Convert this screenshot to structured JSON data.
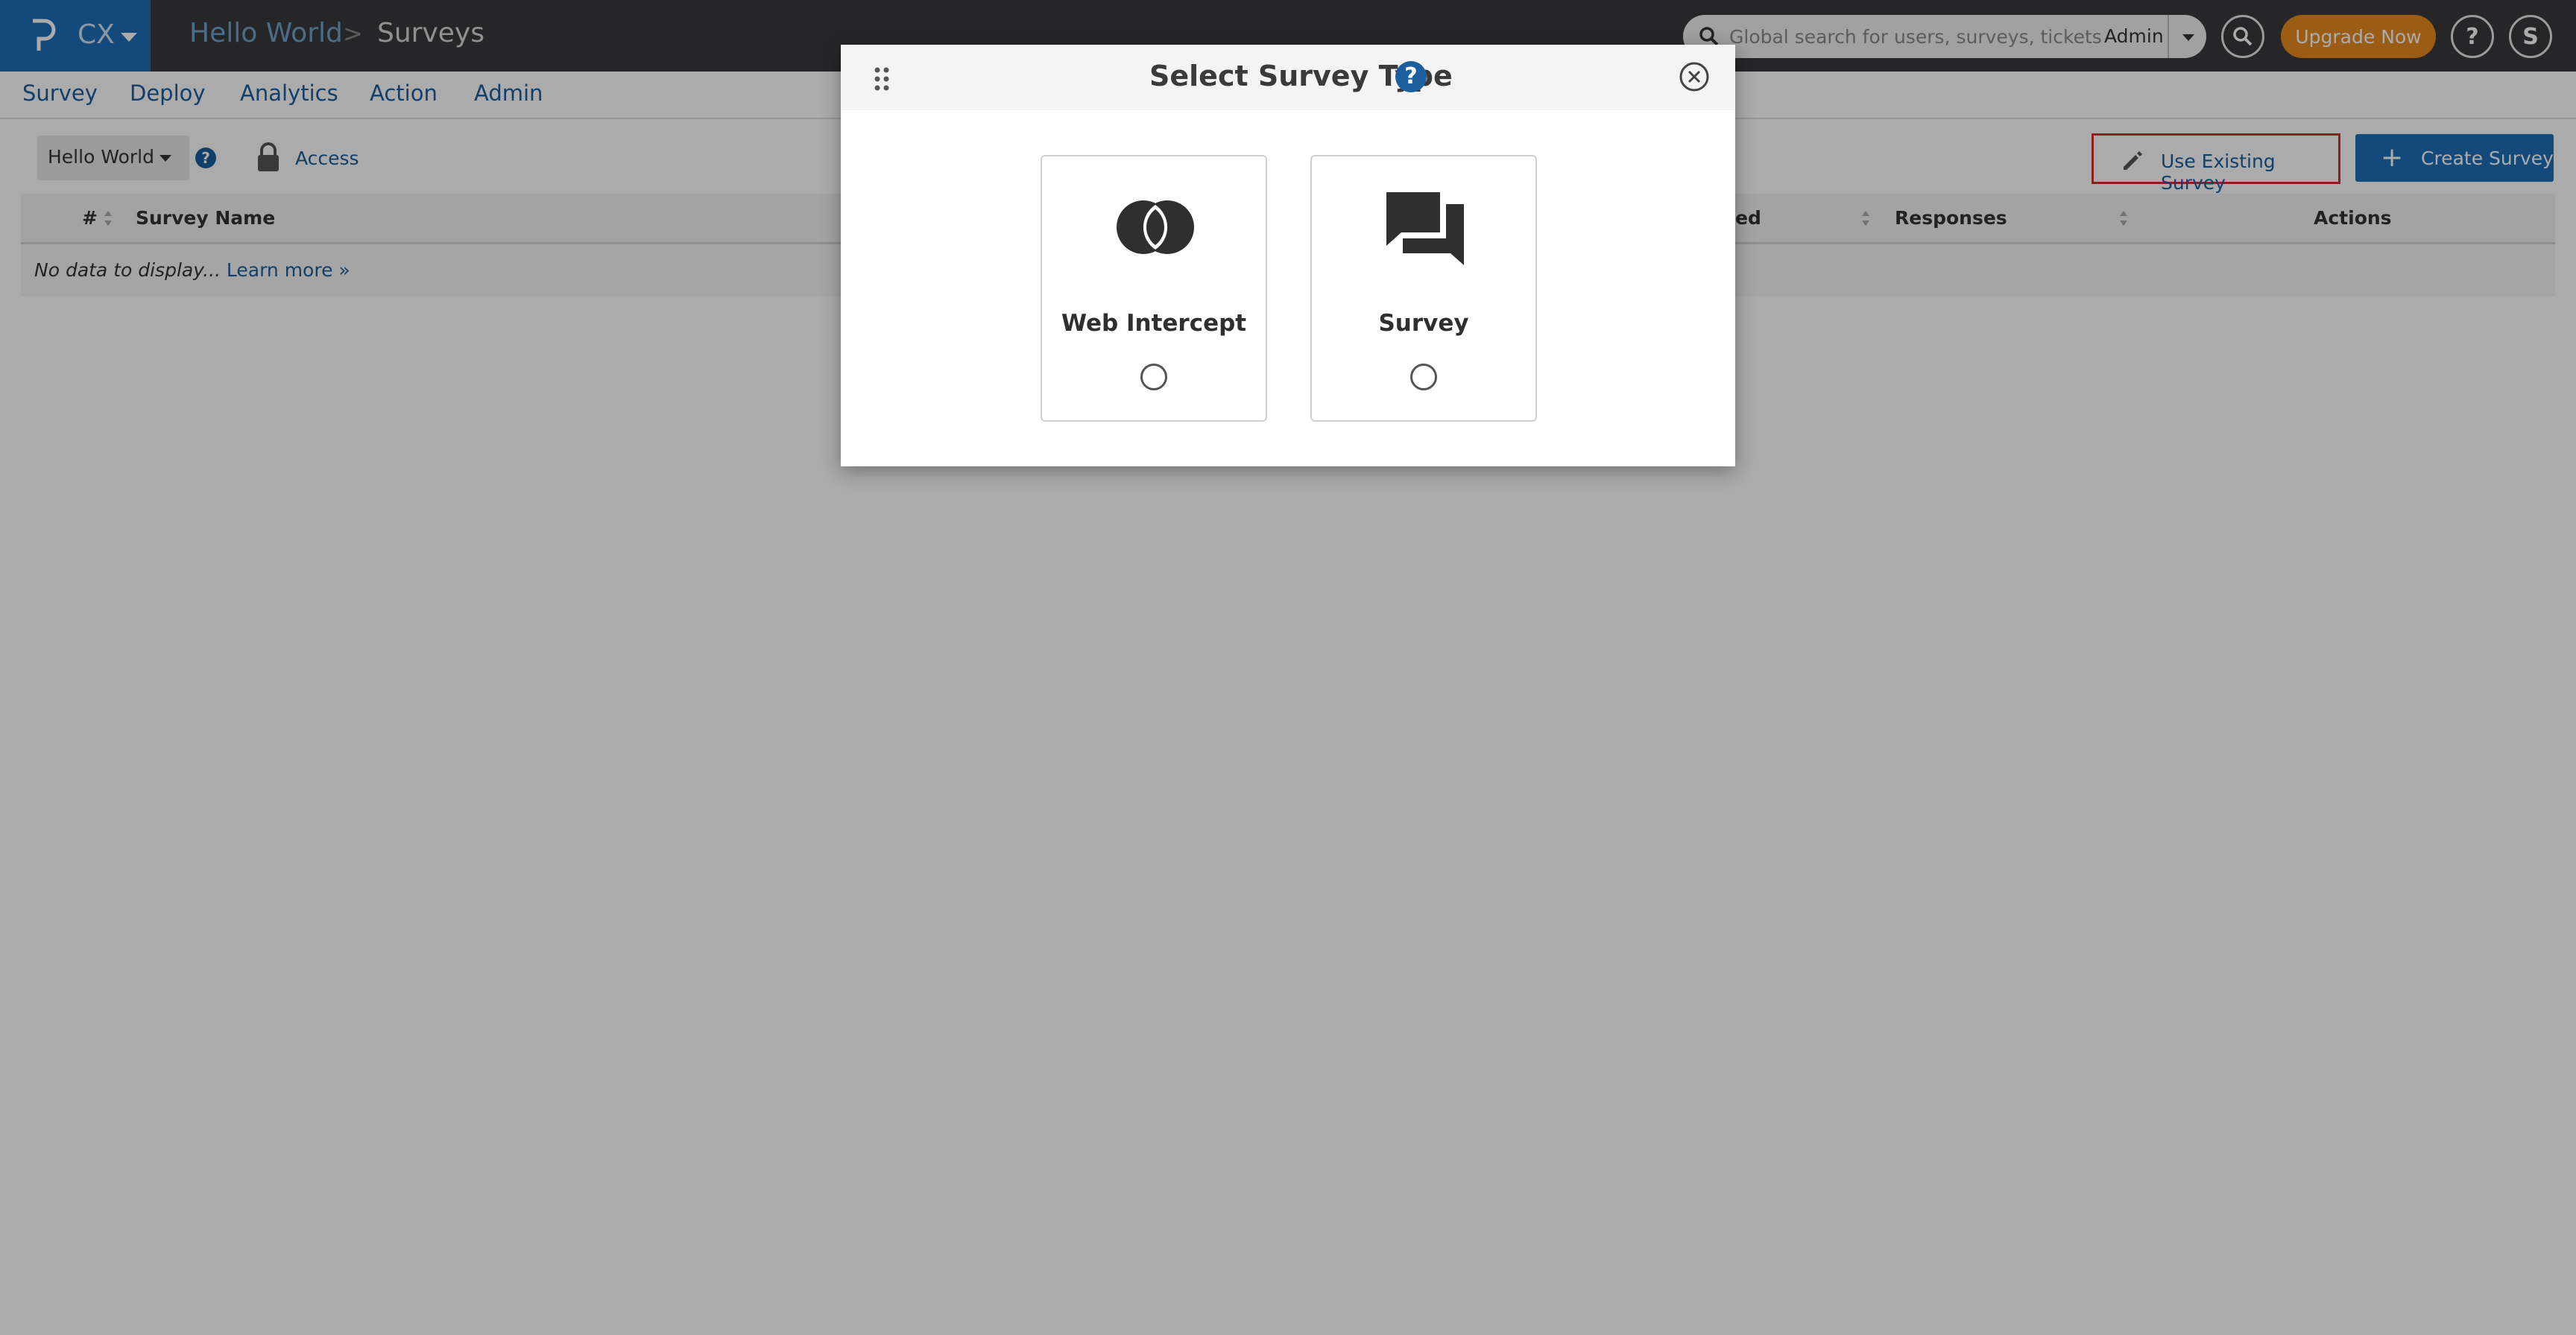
{
  "topbar": {
    "product": "CX",
    "breadcrumb": [
      "Hello World",
      "Surveys"
    ],
    "breadcrumb_separator": ">",
    "search_placeholder": "Global search for users, surveys, tickets",
    "search_scope": "Admin",
    "upgrade_label": "Upgrade Now",
    "help_label": "?",
    "avatar_initial": "S",
    "brand_color": "#1f6fb8",
    "upgrade_color": "#e8891d"
  },
  "nav": {
    "items": [
      "Survey",
      "Deploy",
      "Analytics",
      "Action",
      "Admin"
    ]
  },
  "toolbar": {
    "folder": "Hello World",
    "help": "?",
    "access": "Access",
    "use_existing": "Use Existing Survey",
    "create_plus": "+",
    "create": "Create Survey"
  },
  "table": {
    "columns": [
      "#",
      "Survey Name",
      "ed",
      "Responses",
      "Actions"
    ],
    "empty_text": "No data to display...",
    "learn_more": "Learn more »"
  },
  "modal": {
    "title": "Select Survey Type",
    "help": "?",
    "options": [
      {
        "label": "Web Intercept",
        "icon": "intercept-icon",
        "selected": false
      },
      {
        "label": "Survey",
        "icon": "chat-bubbles-icon",
        "selected": false
      }
    ]
  }
}
